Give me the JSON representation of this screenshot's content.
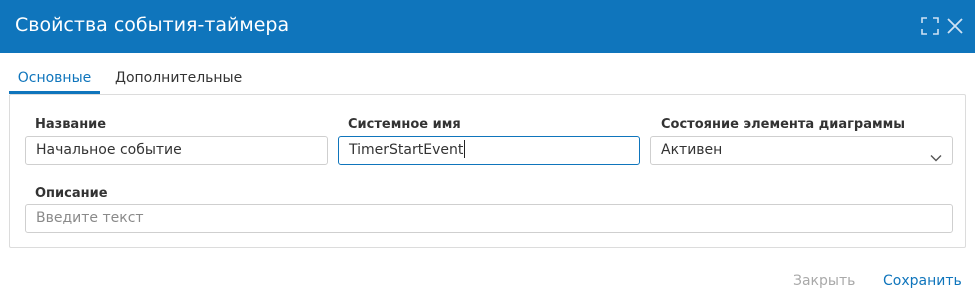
{
  "dialog": {
    "title": "Свойства события-таймера",
    "accent_color": "#0f75bc",
    "icons": [
      "maximize-icon",
      "close-icon"
    ]
  },
  "tabs": [
    {
      "label": "Основные",
      "active": true
    },
    {
      "label": "Дополнительные",
      "active": false
    }
  ],
  "form": {
    "name": {
      "label": "Название",
      "value": "Начальное событие"
    },
    "system_name": {
      "label": "Системное имя",
      "value": "TimerStartEvent"
    },
    "state": {
      "label": "Состояние элемента диаграммы",
      "value": "Активен"
    },
    "description": {
      "label": "Описание",
      "value": "",
      "placeholder": "Введите текст"
    }
  },
  "footer": {
    "close_label": "Закрыть",
    "save_label": "Сохранить",
    "close_color": "#a9a9a9",
    "save_color": "#0f75bc"
  }
}
